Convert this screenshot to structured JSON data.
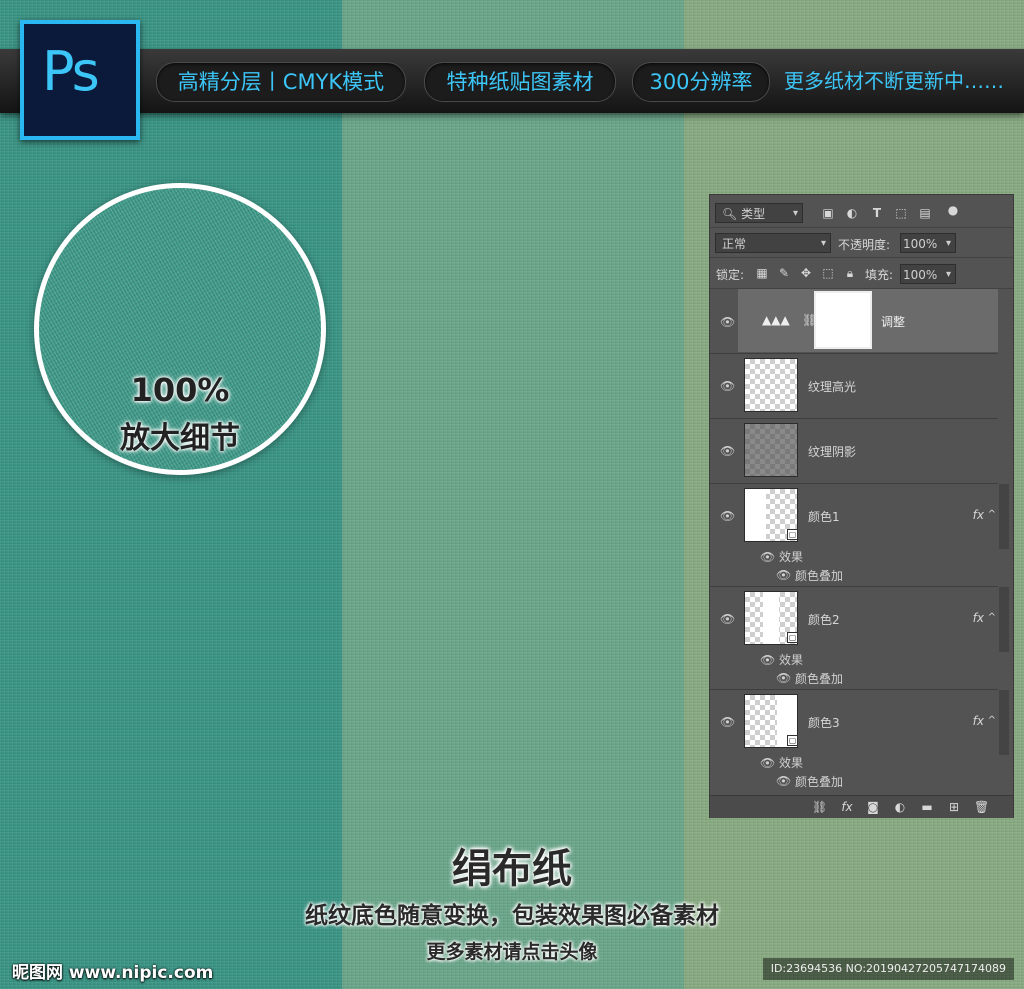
{
  "banner": {
    "logo_text": "Ps",
    "pills": [
      "高精分层丨CMYK模式",
      "特种纸贴图素材",
      "300分辨率"
    ],
    "more_text": "更多纸材不断更新中……"
  },
  "zoom": {
    "percent": "100%",
    "label": "放大细节"
  },
  "layers_panel": {
    "filter_label": "类型",
    "blend_mode": "正常",
    "opacity_label": "不透明度:",
    "opacity_value": "100%",
    "lock_label": "锁定:",
    "fill_label": "填充:",
    "fill_value": "100%",
    "layers": [
      {
        "name": "调整",
        "selected": true
      },
      {
        "name": "纹理高光"
      },
      {
        "name": "纹理阴影"
      },
      {
        "name": "颜色1",
        "fx": "fx",
        "effects_label": "效果",
        "effect": "颜色叠加"
      },
      {
        "name": "颜色2",
        "fx": "fx",
        "effects_label": "效果",
        "effect": "颜色叠加"
      },
      {
        "name": "颜色3",
        "fx": "fx",
        "effects_label": "效果",
        "effect": "颜色叠加"
      }
    ]
  },
  "footer": {
    "title": "绢布纸",
    "subtitle": "纸纹底色随意变换，包装效果图必备素材",
    "subtitle2": "更多素材请点击头像",
    "watermark": "昵图网 www.nipic.com",
    "id_text": "ID:23694536 NO:20190427205747174089"
  },
  "colors": {
    "stripe_left": "#3a9484",
    "stripe_mid": "#6aa68a",
    "stripe_right": "#88aa82",
    "accent": "#3cc6f7"
  }
}
